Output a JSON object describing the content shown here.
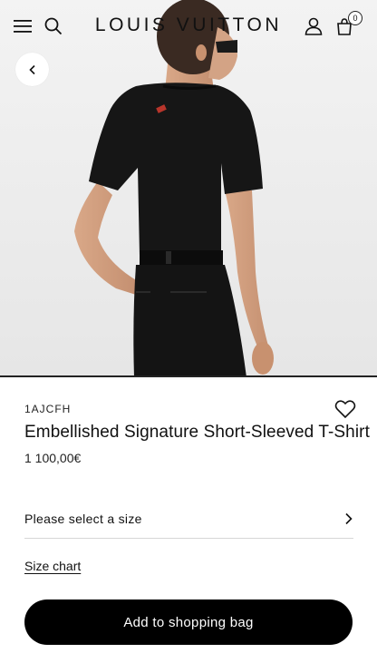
{
  "header": {
    "brand": "LOUIS VUITTON",
    "bag_count": "0",
    "icons": [
      "menu-icon",
      "search-icon",
      "account-icon",
      "shopping-bag-icon"
    ]
  },
  "product": {
    "sku": "1AJCFH",
    "title": "Embellished Signature Short-Sleeved T-Shirt",
    "price": "1 100,00€",
    "image_alt": "Model wearing black short-sleeved t-shirt, back view"
  },
  "actions": {
    "size_select_label": "Please select a size",
    "size_chart_label": "Size chart",
    "add_to_bag_label": "Add to shopping bag"
  },
  "colors": {
    "background": "#ffffff",
    "hero_background": "#eeeeee",
    "primary_button": "#000000",
    "text": "#111111"
  }
}
